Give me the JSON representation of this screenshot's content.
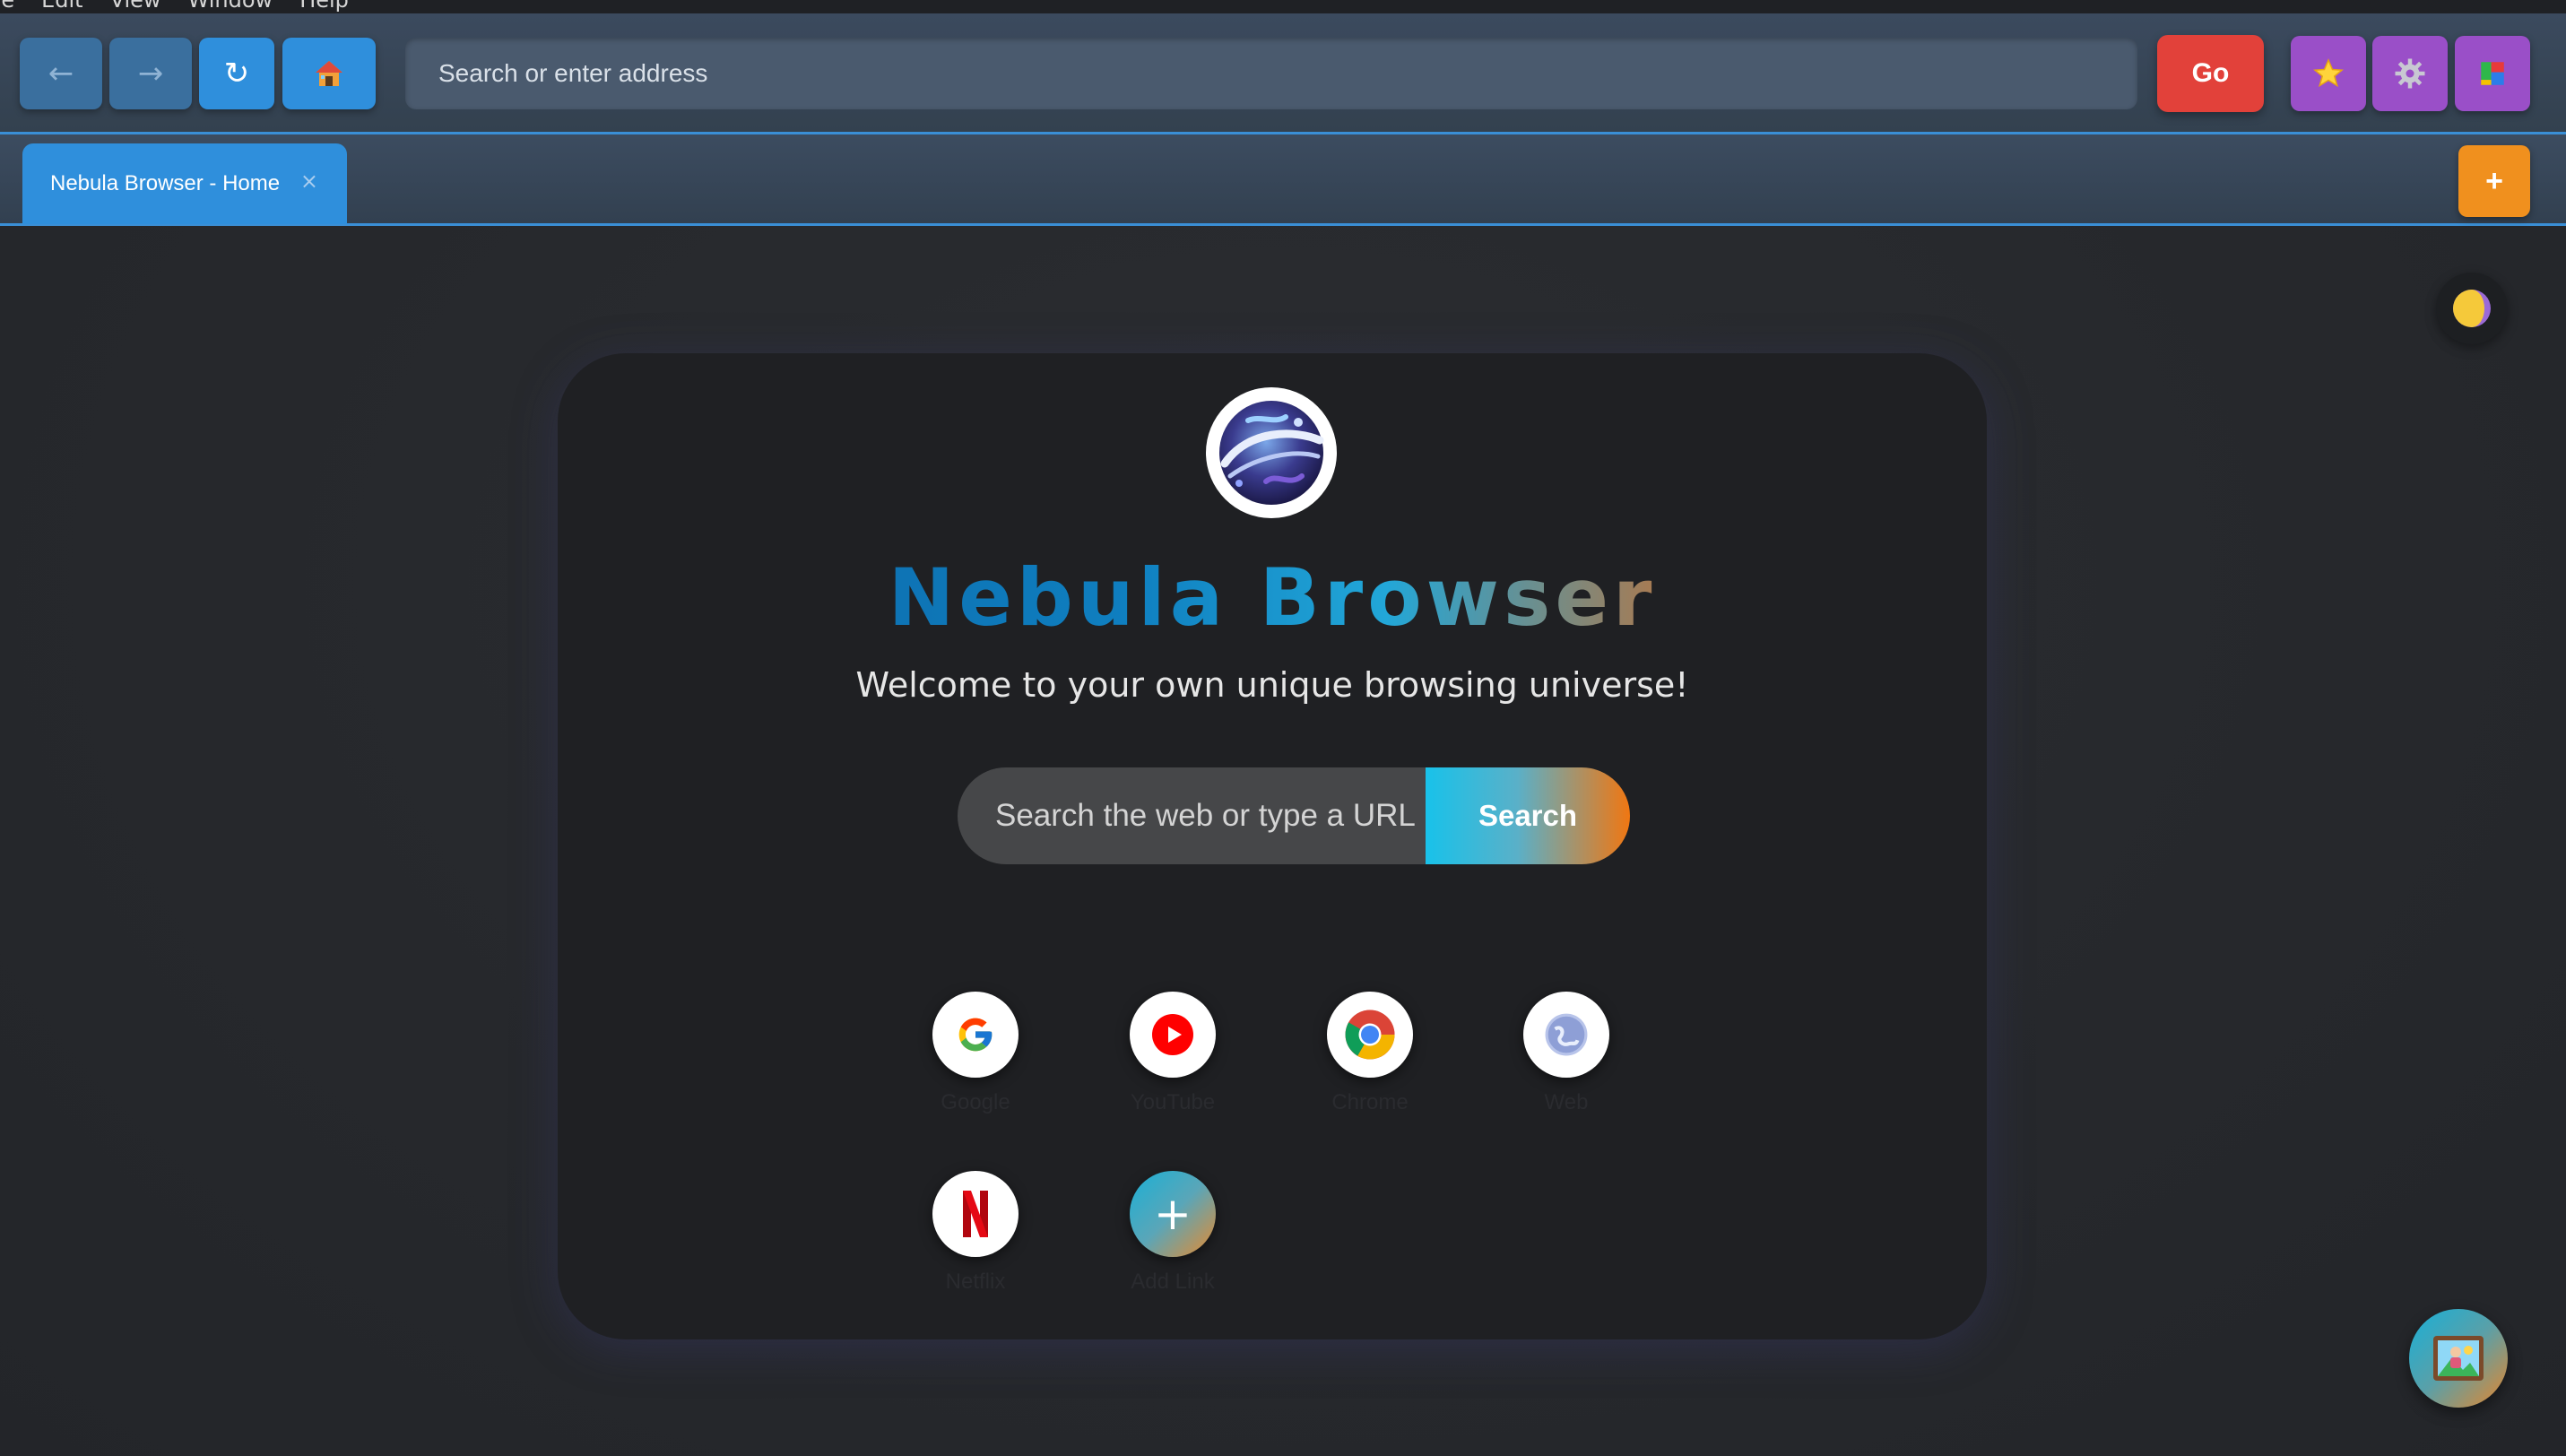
{
  "menubar": {
    "items": [
      "ile",
      "Edit",
      "View",
      "Window",
      "Help"
    ]
  },
  "toolbar": {
    "back_symbol": "←",
    "forward_symbol": "→",
    "reload_symbol": "↻",
    "home_icon": "house-icon",
    "address_placeholder": "Search or enter address",
    "go_label": "Go",
    "bookmark_icon": "star-icon",
    "settings_icon": "gear-icon",
    "extensions_icon": "extensions-icon"
  },
  "tabs": [
    {
      "title": "Nebula Browser - Home",
      "close_symbol": "×",
      "active": true
    }
  ],
  "new_tab_symbol": "+",
  "main": {
    "brand_title": "Nebula Browser",
    "welcome_text": "Welcome to your own unique browsing universe!",
    "search_placeholder": "Search the web or type a URL",
    "search_button": "Search",
    "shortcuts": [
      {
        "label": "Google",
        "icon": "google-icon"
      },
      {
        "label": "YouTube",
        "icon": "youtube-icon"
      },
      {
        "label": "Chrome",
        "icon": "chrome-icon"
      },
      {
        "label": "Web",
        "icon": "globe-icon"
      },
      {
        "label": "Netflix",
        "icon": "netflix-icon"
      },
      {
        "label": "Add Link",
        "icon": "plus-icon",
        "symbol": "+"
      }
    ]
  },
  "theme_toggle_icon": "half-moon-icon",
  "background_button_icon": "image-icon",
  "colors": {
    "accent_blue": "#2f8fdc",
    "go_red": "#e2413a",
    "purple": "#9a4fc8",
    "orange": "#f0901e",
    "card_bg": "#1f2023"
  }
}
